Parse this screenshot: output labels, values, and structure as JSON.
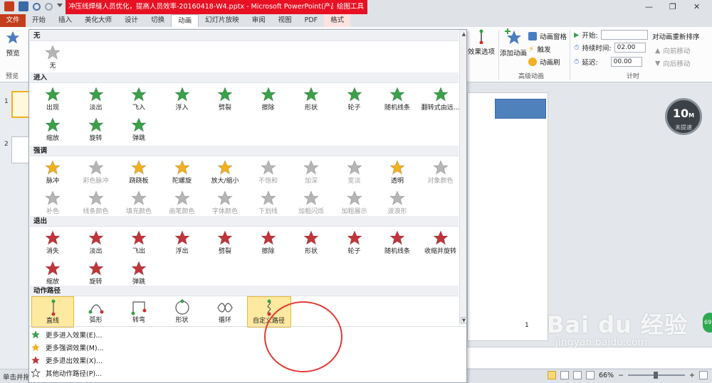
{
  "window": {
    "title": "冲压线焊缝人员优化，提高人员效率-20160418-W4.pptx - Microsoft PowerPoint(产品激...",
    "tool_tab_group": "绘图工具"
  },
  "tabs": [
    "文件",
    "开始",
    "插入",
    "美化大师",
    "设计",
    "切换",
    "动画",
    "幻灯片放映",
    "审阅",
    "视图",
    "PDF",
    "格式"
  ],
  "ribbon": {
    "preview_label": "预览",
    "preview_group": "预览",
    "effect_options": "效果选项",
    "add_animation": "添加动画",
    "animation_pane": "动画窗格",
    "trigger": "触发",
    "animation_painter": "动画刷",
    "advanced_group": "高级动画",
    "start_label": "开始:",
    "start_value": "",
    "duration_label": "持续时间:",
    "duration_value": "02.00",
    "delay_label": "延迟:",
    "delay_value": "00.00",
    "timing_group": "计时",
    "reorder_title": "对动画重新排序",
    "move_earlier": "向前移动",
    "move_later": "向后移动"
  },
  "gallery": {
    "sections": {
      "none": "无",
      "entrance": "进入",
      "emphasis": "强调",
      "exit": "退出",
      "paths": "动作路径"
    },
    "none_items": [
      "无"
    ],
    "entrance_items": [
      "出现",
      "淡出",
      "飞入",
      "浮入",
      "劈裂",
      "擦除",
      "形状",
      "轮子",
      "随机线条",
      "翻转式由远...",
      "缩放",
      "旋转",
      "弹跳"
    ],
    "emphasis_items": [
      "脉冲",
      "彩色脉冲",
      "跷跷板",
      "陀螺旋",
      "放大/缩小",
      "不饱和",
      "加深",
      "变淡",
      "透明",
      "对象颜色",
      "补色",
      "线条颜色",
      "填充颜色",
      "画笔颜色",
      "字体颜色",
      "下划线",
      "加粗闪烁",
      "加粗展示",
      "波浪形"
    ],
    "exit_items": [
      "消失",
      "淡出",
      "飞出",
      "浮出",
      "劈裂",
      "擦除",
      "形状",
      "轮子",
      "随机线条",
      "收缩并旋转",
      "缩放",
      "旋转",
      "弹跳"
    ],
    "path_items": [
      "直线",
      "弧形",
      "转弯",
      "形状",
      "循环",
      "自定义路径"
    ],
    "more": [
      "更多进入效果(E)...",
      "更多强调效果(M)...",
      "更多退出效果(X)...",
      "其他动作路径(P)..."
    ]
  },
  "slides": {
    "numbers": [
      "1",
      "2"
    ],
    "current_page_num": "1"
  },
  "timer": {
    "value": "10",
    "unit": "M",
    "sub": "未提速"
  },
  "green_bubble": "69",
  "watermark": {
    "brand": "Bai du 经验",
    "url": "jingyan.baidu.com"
  },
  "status": {
    "left": "单击并拖",
    "zoom": "66%"
  },
  "colors": {
    "title_red": "#e81123",
    "file_tab": "#c43e1c",
    "entrance_star": "#3aa04a",
    "emphasis_star": "#f2b01e",
    "exit_star": "#c0343a",
    "disabled": "#b5b5b5",
    "selected_bg": "#fde9a0"
  }
}
